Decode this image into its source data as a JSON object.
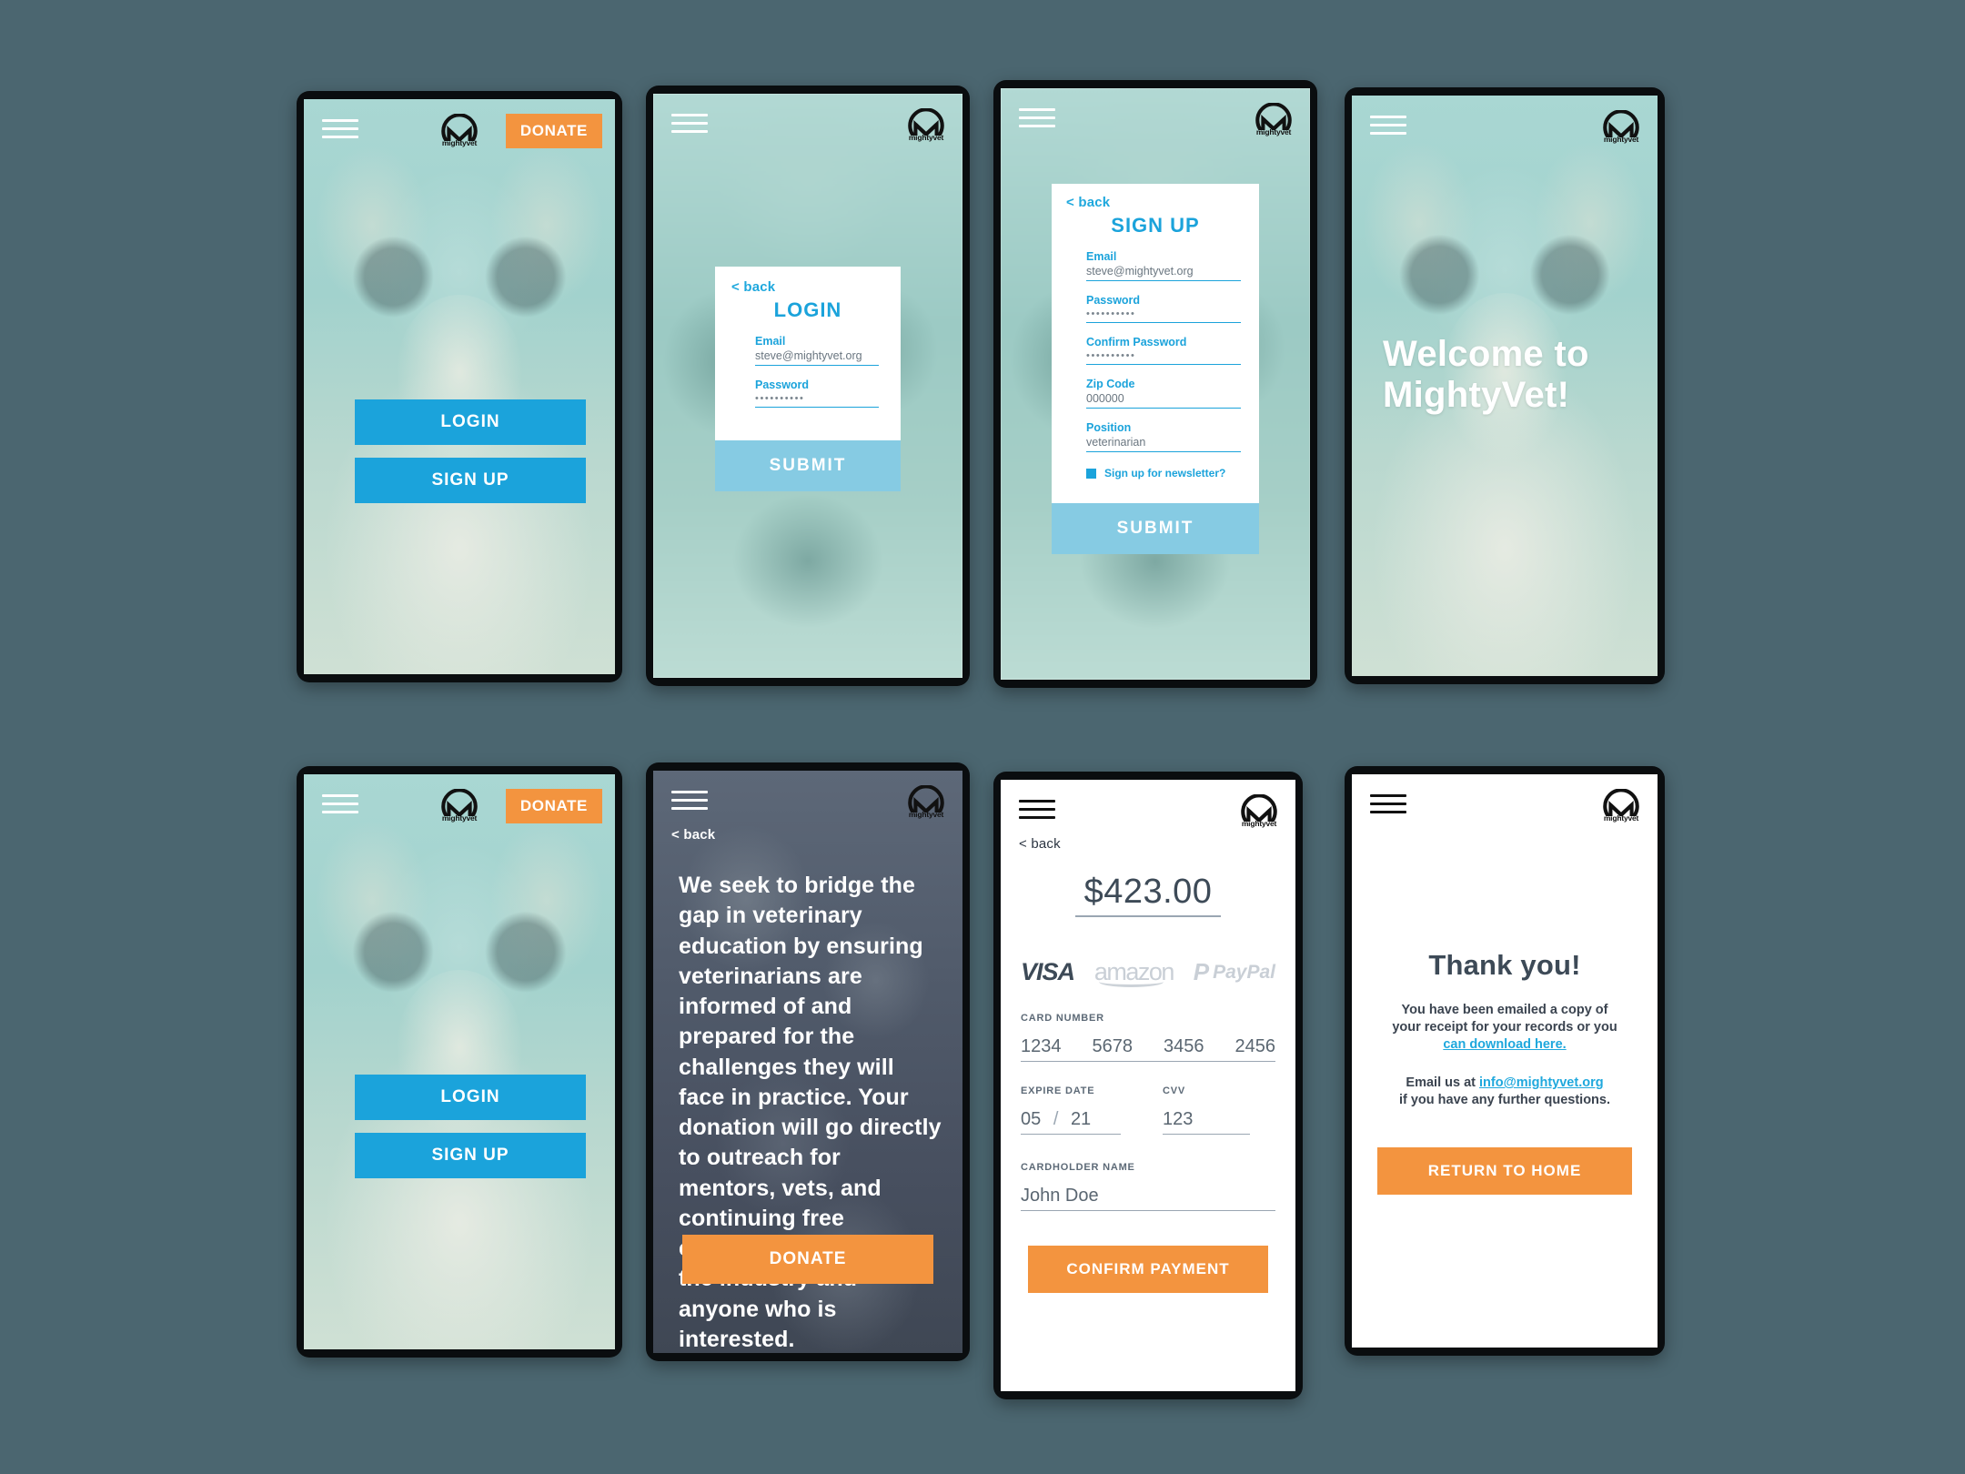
{
  "brand": {
    "name": "mightyvet",
    "accent_blue": "#1ba3db",
    "accent_blue_light": "#86cbe3",
    "accent_orange": "#f3943f",
    "dark_text": "#3d4a57",
    "page_background": "#4b6670"
  },
  "common": {
    "menu_icon": "hamburger-menu-icon",
    "logo_icon": "mightyvet-logo-icon",
    "back_label": "< back"
  },
  "screens": {
    "home": {
      "donate_label": "DONATE",
      "login_label": "LOGIN",
      "signup_label": "SIGN UP"
    },
    "login": {
      "back_label": "< back",
      "title": "LOGIN",
      "email_label": "Email",
      "email_value": "steve@mightyvet.org",
      "password_label": "Password",
      "password_value": "••••••••••",
      "submit_label": "SUBMIT"
    },
    "signup": {
      "back_label": "< back",
      "title": "SIGN UP",
      "email_label": "Email",
      "email_value": "steve@mightyvet.org",
      "password_label": "Password",
      "password_value": "••••••••••",
      "confirm_password_label": "Confirm Password",
      "confirm_password_value": "••••••••••",
      "zip_label": "Zip Code",
      "zip_value": "000000",
      "position_label": "Position",
      "position_value": "veterinarian",
      "newsletter_label": "Sign up for newsletter?",
      "newsletter_checked": true,
      "submit_label": "SUBMIT"
    },
    "welcome": {
      "line1": "Welcome to",
      "line2": "MightyVet!"
    },
    "home2": {
      "donate_label": "DONATE",
      "login_label": "LOGIN",
      "signup_label": "SIGN UP"
    },
    "donate": {
      "back_label": "< back",
      "mission_text": "We seek to bridge the gap in veterinary education by ensuring veterinarians are informed of and prepared for the challenges they will face in practice.  Your donation will go directly to outreach for mentors, vets, and continuing free education for those in the industry and anyone who is interested.",
      "donate_label": "DONATE"
    },
    "payment": {
      "back_label": "< back",
      "amount": "$423.00",
      "logos": {
        "visa": "VISA",
        "amazon": "amazon",
        "paypal_p": "P",
        "paypal_text": "PayPal"
      },
      "card_number_label": "CARD NUMBER",
      "card_number_groups": [
        "1234",
        "5678",
        "3456",
        "2456"
      ],
      "expire_label": "EXPIRE DATE",
      "expire_month": "05",
      "expire_sep": "/",
      "expire_year": "21",
      "cvv_label": "CVV",
      "cvv_value": "123",
      "cardholder_label": "CARDHOLDER NAME",
      "cardholder_value": "John Doe",
      "confirm_label": "CONFIRM PAYMENT"
    },
    "thankyou": {
      "title": "Thank you!",
      "line1": "You have been emailed a copy of",
      "line2": "your receipt for your records or you",
      "download_link": "can download here.",
      "line3_pre": "Email us at ",
      "email_link": "info@mightyvet.org",
      "line4": "if you have any further questions.",
      "return_label": "RETURN TO HOME"
    }
  }
}
